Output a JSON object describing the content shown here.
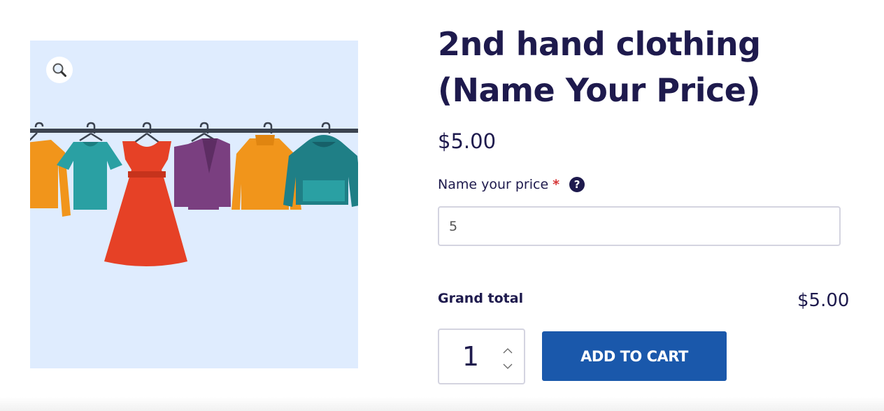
{
  "gallery": {
    "zoom_icon": "magnifier-icon",
    "image_icon": "clothing-rack-illustration",
    "colors": {
      "background": "#dfecfe"
    }
  },
  "product": {
    "title_line1": "2nd hand clothing",
    "title_line2": "(Name Your Price)",
    "price": "$5.00"
  },
  "nyp": {
    "label": "Name your price",
    "required_mark": "*",
    "help_icon": "question-circle-icon",
    "help_glyph": "?",
    "value": "5"
  },
  "total": {
    "label": "Grand total",
    "value": "$5.00"
  },
  "cart": {
    "quantity": "1",
    "add_label": "ADD TO CART",
    "colors": {
      "button": "#1a58ab"
    }
  }
}
